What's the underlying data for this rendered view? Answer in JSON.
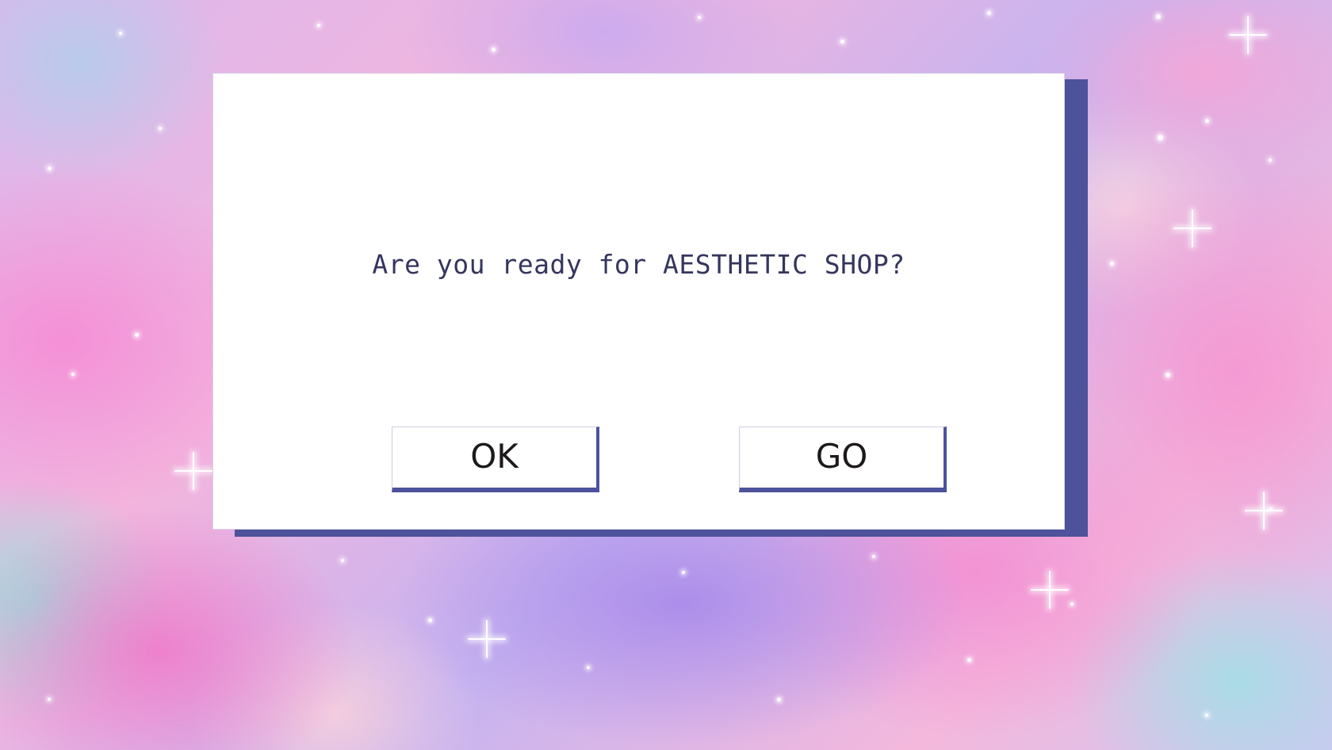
{
  "dialog": {
    "message": "Are you ready for AESTHETIC SHOP?",
    "ok_label": "OK",
    "go_label": "GO"
  },
  "colors": {
    "dialog_shadow": "#4d529b",
    "dialog_background": "#ffffff",
    "message_text": "#35365e",
    "button_text": "#1e1a1a"
  }
}
